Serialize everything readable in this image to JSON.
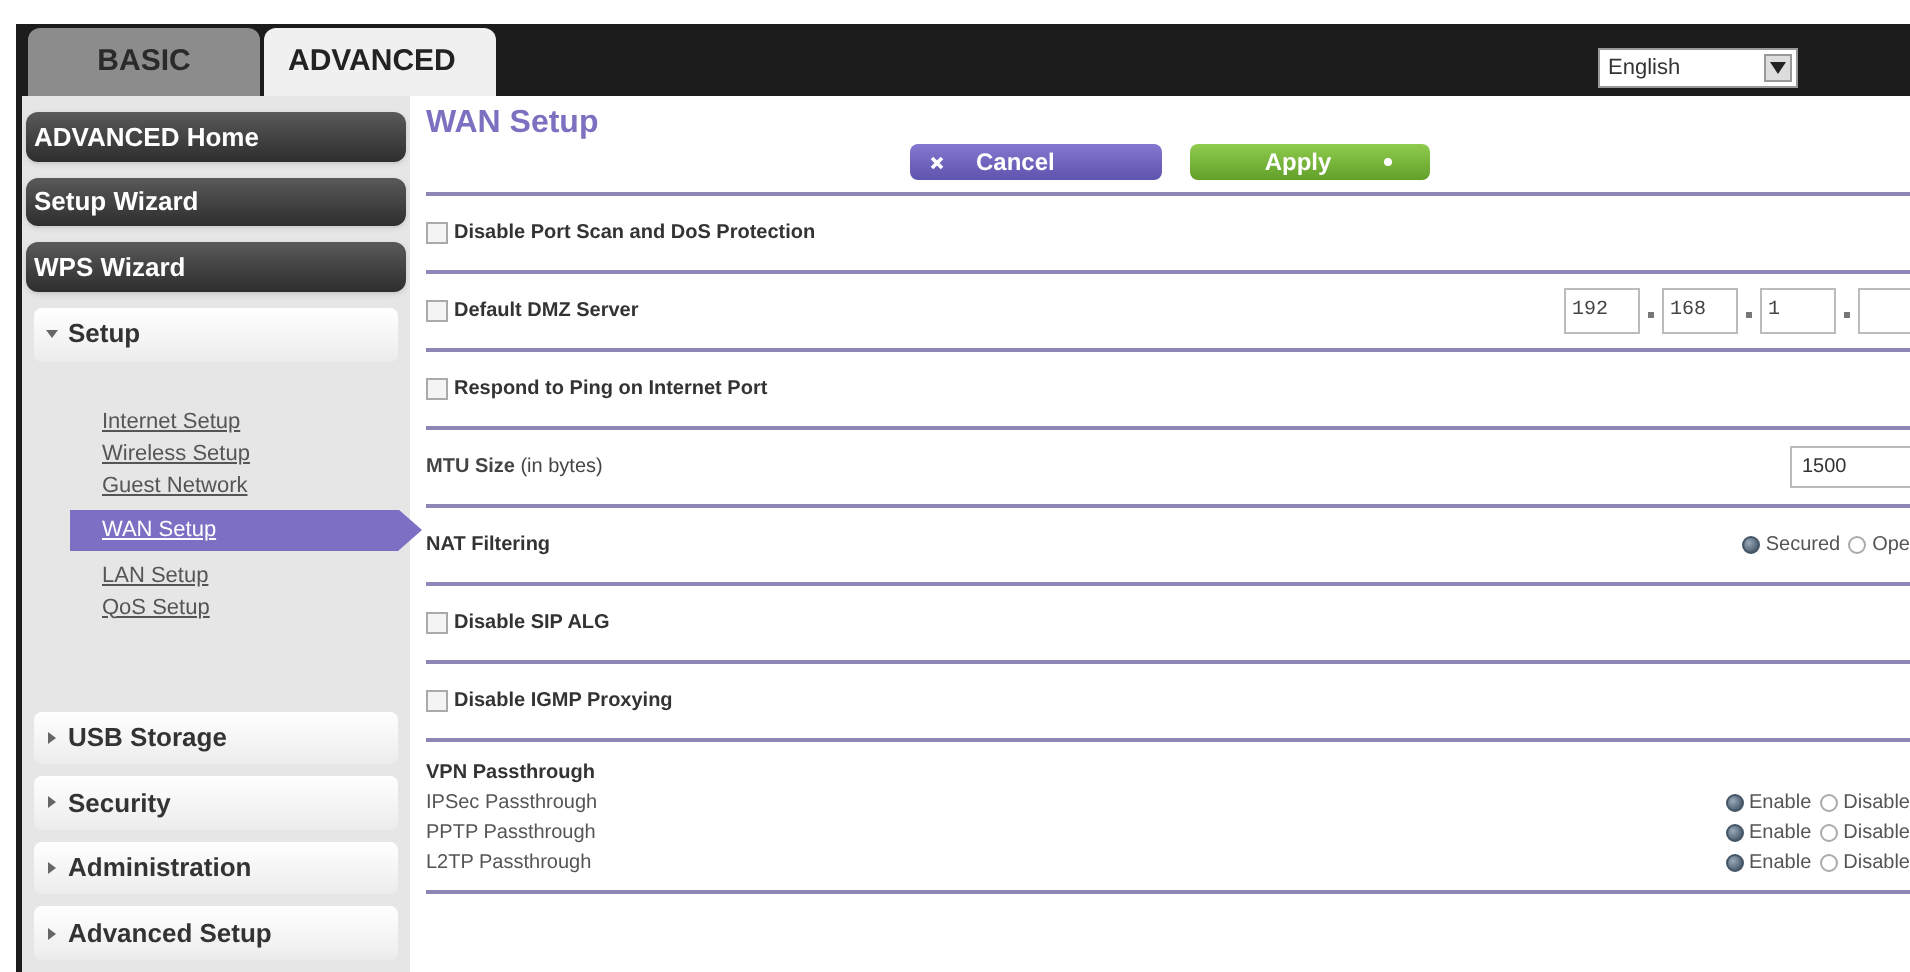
{
  "tabs": [
    {
      "label": "BASIC",
      "selected": false
    },
    {
      "label": "ADVANCED",
      "selected": true
    }
  ],
  "language_select": {
    "value": "English"
  },
  "sidebar": {
    "buttons": [
      {
        "label": "ADVANCED Home"
      },
      {
        "label": "Setup Wizard"
      },
      {
        "label": "WPS Wizard"
      }
    ],
    "sections": [
      {
        "label": "Setup",
        "expanded": true,
        "children": [
          {
            "label": "Internet Setup",
            "selected": false
          },
          {
            "label": "Wireless Setup",
            "selected": false
          },
          {
            "label": "Guest Network",
            "selected": false
          },
          {
            "label": "WAN Setup",
            "selected": true
          },
          {
            "label": "LAN Setup",
            "selected": false
          },
          {
            "label": "QoS Setup",
            "selected": false
          }
        ]
      },
      {
        "label": "USB Storage",
        "expanded": false
      },
      {
        "label": "Security",
        "expanded": false
      },
      {
        "label": "Administration",
        "expanded": false
      },
      {
        "label": "Advanced Setup",
        "expanded": false
      }
    ]
  },
  "page": {
    "title": "WAN Setup",
    "buttons": [
      {
        "label": "Cancel",
        "kind": "cancel"
      },
      {
        "label": "Apply",
        "kind": "apply"
      }
    ],
    "rows": [
      {
        "kind": "checkbox",
        "label": "Disable Port Scan and DoS Protection",
        "checked": false
      },
      {
        "kind": "ip",
        "label": "Default DMZ Server",
        "checked": false,
        "octets": [
          "192",
          "168",
          "1"
        ]
      },
      {
        "kind": "checkbox",
        "label": "Respond to Ping on Internet Port",
        "checked": false
      },
      {
        "kind": "text",
        "label": "**MTU Size** (in bytes)",
        "value": "1500"
      },
      {
        "kind": "radio",
        "label": "NAT Filtering",
        "options": [
          {
            "label": "Secured",
            "selected": true
          },
          {
            "label": "Ope",
            "selected": false
          }
        ]
      },
      {
        "kind": "checkbox",
        "label": "Disable SIP ALG",
        "checked": false
      },
      {
        "kind": "checkbox",
        "label": "Disable IGMP Proxying",
        "checked": false
      },
      {
        "kind": "group",
        "label": "VPN Passthrough",
        "items": [
          {
            "label": "IPSec Passthrough",
            "options": [
              {
                "label": "Enable",
                "selected": true
              },
              {
                "label": "Disable",
                "selected": false
              }
            ]
          },
          {
            "label": "PPTP Passthrough",
            "options": [
              {
                "label": "Enable",
                "selected": true
              },
              {
                "label": "Disable",
                "selected": false
              }
            ]
          },
          {
            "label": "L2TP Passthrough",
            "options": [
              {
                "label": "Enable",
                "selected": true
              },
              {
                "label": "Disable",
                "selected": false
              }
            ]
          }
        ]
      }
    ]
  }
}
